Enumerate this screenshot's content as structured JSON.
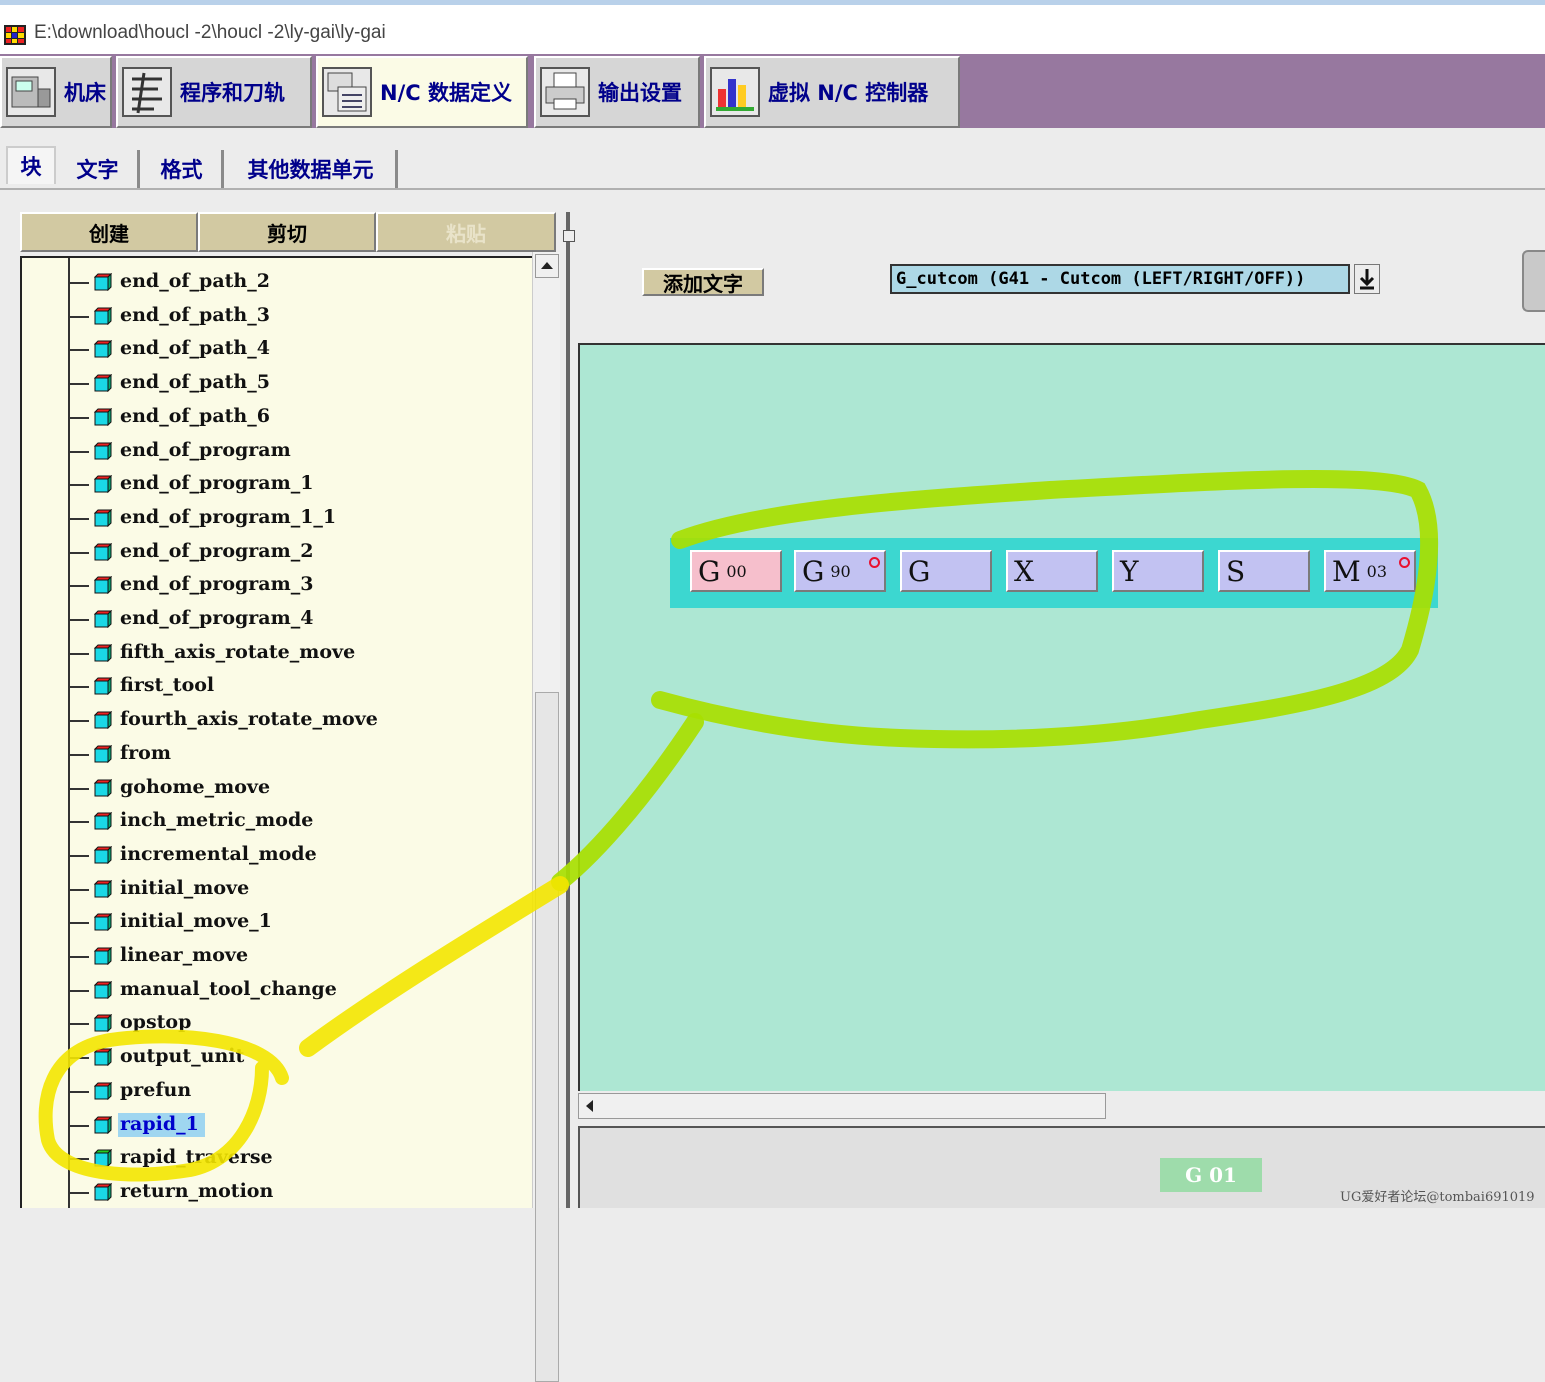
{
  "window": {
    "title": "E:\\download\\houcl -2\\houcl -2\\ly-gai\\ly-gai"
  },
  "main_tabs": [
    {
      "label": "机床",
      "icon": "machine-tool-icon"
    },
    {
      "label": "程序和刀轨",
      "icon": "program-toolpath-icon"
    },
    {
      "label": "N/C 数据定义",
      "icon": "nc-data-definition-icon",
      "active": true
    },
    {
      "label": "输出设置",
      "icon": "printer-icon"
    },
    {
      "label": "虚拟 N/C 控制器",
      "icon": "virtual-controller-icon"
    }
  ],
  "sub_tabs": [
    {
      "label": "块",
      "active": true
    },
    {
      "label": "文字"
    },
    {
      "label": "格式"
    },
    {
      "label": "其他数据单元"
    }
  ],
  "tree_buttons": {
    "create": "创建",
    "cut": "剪切",
    "paste": "粘贴"
  },
  "tree": {
    "items": [
      "end_of_path_2",
      "end_of_path_3",
      "end_of_path_4",
      "end_of_path_5",
      "end_of_path_6",
      "end_of_program",
      "end_of_program_1",
      "end_of_program_1_1",
      "end_of_program_2",
      "end_of_program_3",
      "end_of_program_4",
      "fifth_axis_rotate_move",
      "first_tool",
      "fourth_axis_rotate_move",
      "from",
      "gohome_move",
      "inch_metric_mode",
      "incremental_mode",
      "initial_move",
      "initial_move_1",
      "linear_move",
      "manual_tool_change",
      "opstop",
      "output_unit",
      "prefun",
      "rapid_1",
      "rapid_traverse",
      "return_motion"
    ],
    "selected": "rapid_1"
  },
  "editor": {
    "add_word_label": "添加文字",
    "word_select": "G_cutcom (G41 - Cutcom (LEFT/RIGHT/OFF))",
    "words": [
      {
        "letter": "G",
        "sub": "00",
        "optional": false
      },
      {
        "letter": "G",
        "sub": "90",
        "optional": true
      },
      {
        "letter": "G",
        "sub": "",
        "optional": false
      },
      {
        "letter": "X",
        "sub": "",
        "optional": false
      },
      {
        "letter": "Y",
        "sub": "",
        "optional": false
      },
      {
        "letter": "S",
        "sub": "",
        "optional": false
      },
      {
        "letter": "M",
        "sub": "03",
        "optional": true
      }
    ],
    "preview": "G  01"
  },
  "watermark": "UG爱好者论坛@tombai691019",
  "colors": {
    "toolbar_bg": "#97789f",
    "canvas_bg": "#ade7d3",
    "word_row_bg": "#3cd7d0",
    "word_bg": "#c2c2f2",
    "word_first_bg": "#f6bfcc",
    "tree_bg": "#fbfbe6",
    "selection": "#9fd6f0",
    "annotation_green": "#a8e000",
    "annotation_yellow": "#f3e600"
  }
}
